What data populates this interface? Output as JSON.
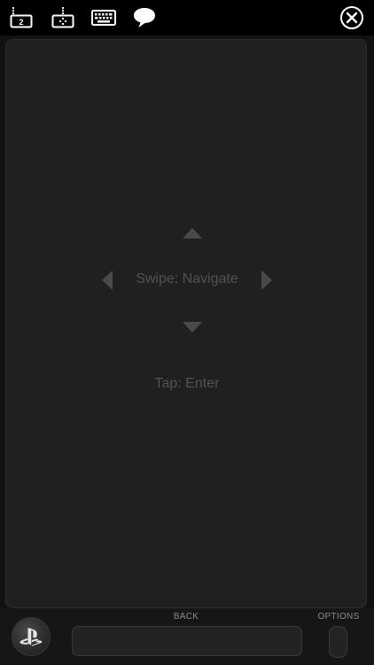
{
  "toolbar": {
    "buttons": [
      {
        "name": "second-screen-icon",
        "badge": "2"
      },
      {
        "name": "controller-icon"
      },
      {
        "name": "keyboard-icon"
      },
      {
        "name": "comment-icon"
      }
    ],
    "close_icon": "close-icon"
  },
  "touchpad": {
    "swipe_label": "Swipe: Navigate",
    "tap_label": "Tap: Enter"
  },
  "bottom": {
    "back_label": "BACK",
    "options_label": "OPTIONS"
  },
  "colors": {
    "background": "#000000",
    "touchpad": "#202020",
    "hint_text": "#525252",
    "arrow": "#4a4a4a",
    "icon": "#ffffff"
  }
}
